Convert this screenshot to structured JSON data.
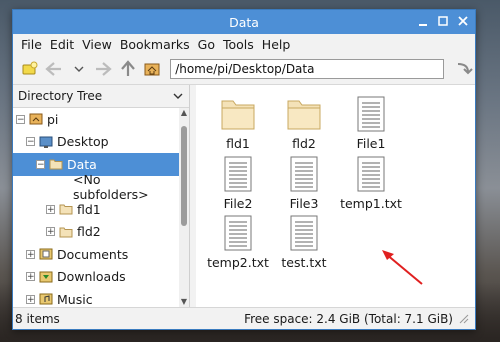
{
  "window": {
    "title": "Data"
  },
  "menu": [
    "File",
    "Edit",
    "View",
    "Bookmarks",
    "Go",
    "Tools",
    "Help"
  ],
  "toolbar": {
    "path": "/home/pi/Desktop/Data"
  },
  "sidebar": {
    "header": "Directory Tree"
  },
  "tree": [
    {
      "label": "pi",
      "icon": "home-folder-icon",
      "expander": "−"
    },
    {
      "label": "Desktop",
      "icon": "desktop-icon",
      "expander": "−"
    },
    {
      "label": "Data",
      "icon": "folder-icon",
      "expander": "−",
      "selected": true
    },
    {
      "label": "<No subfolders>"
    },
    {
      "label": "fld1",
      "icon": "folder-icon",
      "expander": "+"
    },
    {
      "label": "fld2",
      "icon": "folder-icon",
      "expander": "+"
    },
    {
      "label": "Documents",
      "icon": "documents-icon",
      "expander": "+"
    },
    {
      "label": "Downloads",
      "icon": "downloads-icon",
      "expander": "+"
    },
    {
      "label": "Music",
      "icon": "music-icon",
      "expander": "+"
    }
  ],
  "files": [
    {
      "name": "fld1",
      "type": "folder"
    },
    {
      "name": "fld2",
      "type": "folder"
    },
    {
      "name": "File1",
      "type": "file"
    },
    {
      "name": "File2",
      "type": "file"
    },
    {
      "name": "File3",
      "type": "file"
    },
    {
      "name": "temp1.txt",
      "type": "file"
    },
    {
      "name": "temp2.txt",
      "type": "file"
    },
    {
      "name": "test.txt",
      "type": "file"
    }
  ],
  "status": {
    "items": "8 items",
    "free": "Free space: 2.4 GiB (Total: 7.1 GiB)"
  },
  "colors": {
    "accent": "#4d8fd6",
    "annotation_arrow": "#e02020"
  }
}
